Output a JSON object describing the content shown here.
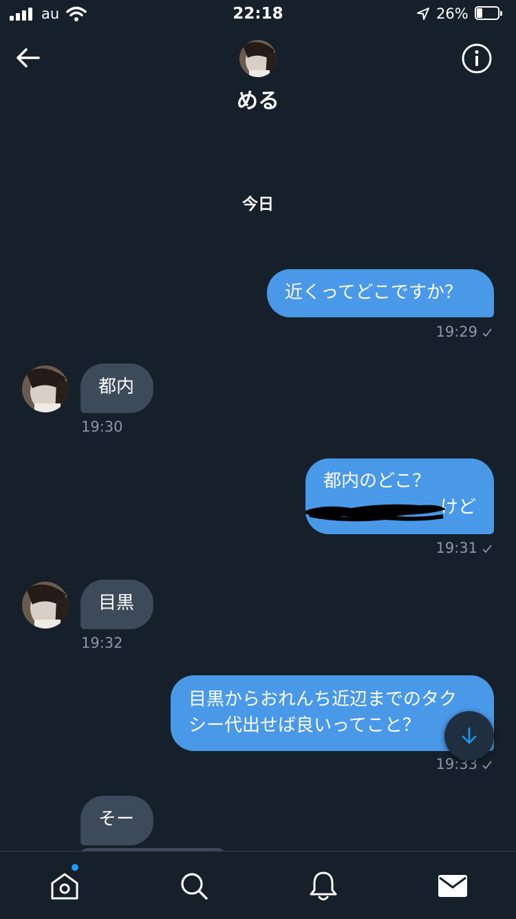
{
  "status_bar": {
    "carrier": "au",
    "time": "22:18",
    "battery_percent": "26%",
    "battery_level": 0.26,
    "icons": [
      "signal-icon",
      "wifi-icon",
      "location-arrow-icon",
      "battery-icon"
    ]
  },
  "header": {
    "name": "める",
    "icons": [
      "back-arrow-icon",
      "info-icon"
    ]
  },
  "date_divider": "今日",
  "messages": [
    {
      "side": "sent",
      "text": "近くってどこですか？",
      "time": "19:29"
    },
    {
      "side": "received",
      "text": "都内",
      "time": "19:30"
    },
    {
      "side": "sent",
      "lines": [
        "都内のどこ？",
        "けど"
      ],
      "time": "19:31"
    },
    {
      "side": "received",
      "text": "目黒",
      "time": "19:32"
    },
    {
      "side": "sent",
      "lines": [
        "目黒からおれんち近辺までのタク",
        "シー代出せば良いってこと？"
      ],
      "time": "19:33"
    },
    {
      "side": "received",
      "text": "そー"
    }
  ],
  "tab_bar": {
    "icons": [
      "home-icon",
      "search-icon",
      "notifications-icon",
      "messages-icon"
    ]
  },
  "colors": {
    "background": "#15202b",
    "sent_bubble": "#4a98e8",
    "received_bubble": "#3d4a59",
    "meta_text": "#8b98a5",
    "accent": "#1d9bf0"
  }
}
